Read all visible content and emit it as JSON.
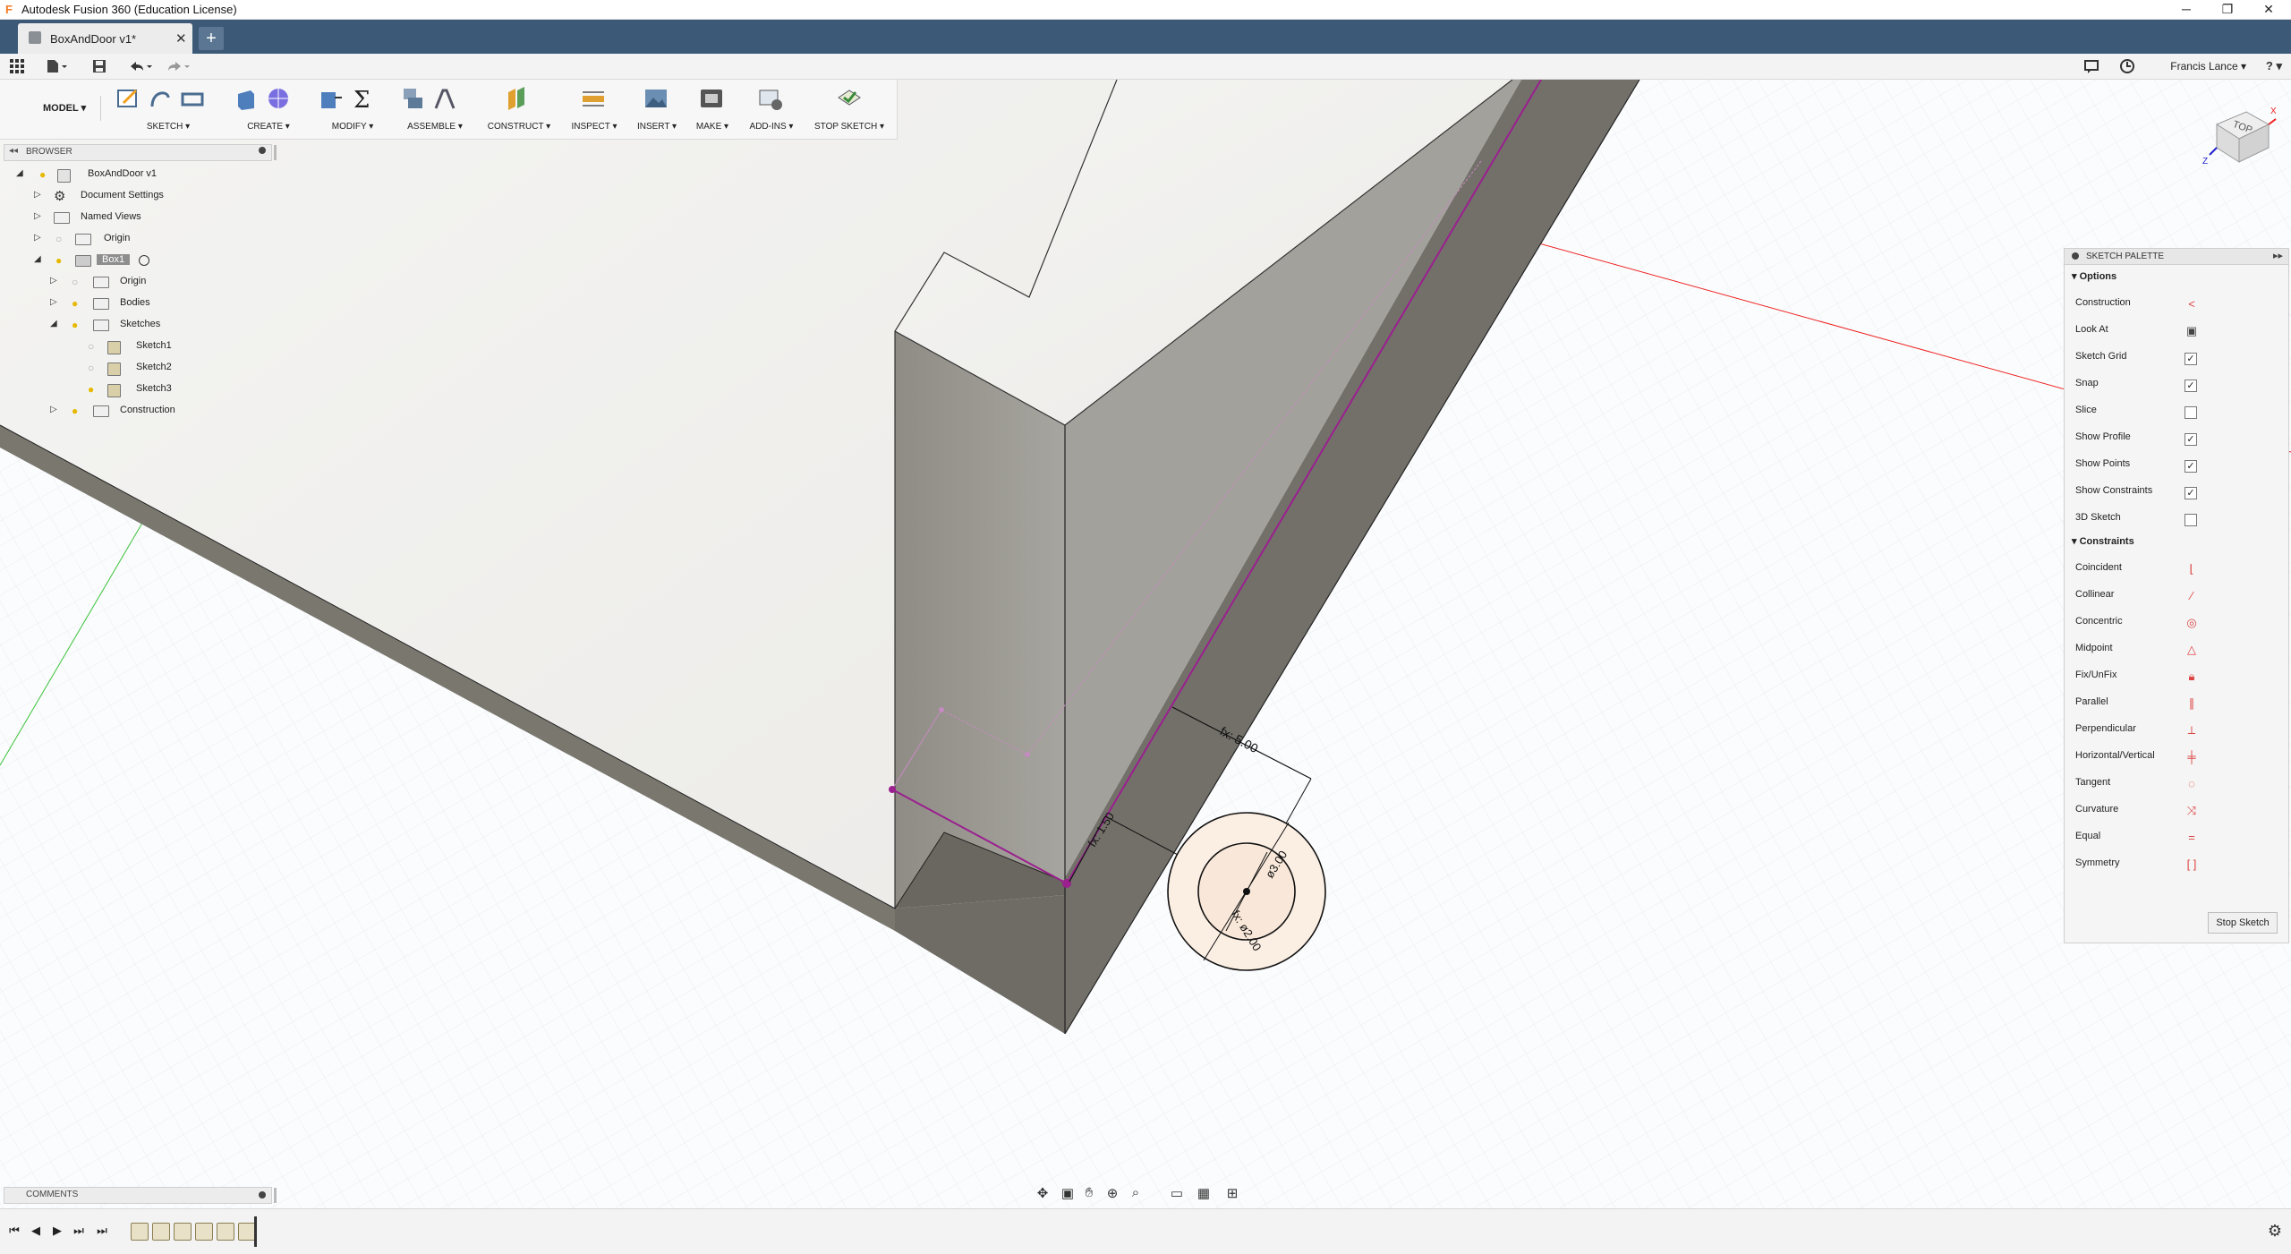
{
  "app": {
    "title": "Autodesk Fusion 360 (Education License)",
    "window_buttons": {
      "minimize": "─",
      "restore": "❐",
      "close": "✕"
    }
  },
  "tabs": {
    "doc_label": "BoxAndDoor v1*",
    "close": "✕",
    "new": "+"
  },
  "quickbar": {
    "user": "Francis Lance ▾",
    "help": "? ▾"
  },
  "toolbar": {
    "workspace": "MODEL ▾",
    "groups": [
      {
        "label": "SKETCH ▾"
      },
      {
        "label": "CREATE ▾"
      },
      {
        "label": "MODIFY ▾"
      },
      {
        "label": "ASSEMBLE ▾"
      },
      {
        "label": "CONSTRUCT ▾"
      },
      {
        "label": "INSPECT ▾"
      },
      {
        "label": "INSERT ▾"
      },
      {
        "label": "MAKE ▾"
      },
      {
        "label": "ADD-INS ▾"
      },
      {
        "label": "STOP SKETCH ▾"
      }
    ]
  },
  "browser": {
    "title": "BROWSER",
    "items": [
      {
        "label": "BoxAndDoor v1"
      },
      {
        "label": "Document Settings"
      },
      {
        "label": "Named Views"
      },
      {
        "label": "Origin"
      },
      {
        "label": "Box1"
      },
      {
        "label": "Origin"
      },
      {
        "label": "Bodies"
      },
      {
        "label": "Sketches"
      },
      {
        "label": "Sketch1"
      },
      {
        "label": "Sketch2"
      },
      {
        "label": "Sketch3"
      },
      {
        "label": "Construction"
      }
    ]
  },
  "viewcube": {
    "face": "TOP",
    "axis_x": "X",
    "axis_z": "Z"
  },
  "dimensions": {
    "d1": "fx: 5.00",
    "d2": "fx: 1.50",
    "d3": "ø3.00",
    "d4": "fx: ø2.00"
  },
  "palette": {
    "title": "SKETCH PALETTE",
    "options_title": "Options",
    "options": [
      {
        "label": "Construction",
        "checked": null
      },
      {
        "label": "Look At",
        "checked": null
      },
      {
        "label": "Sketch Grid",
        "checked": true
      },
      {
        "label": "Snap",
        "checked": true
      },
      {
        "label": "Slice",
        "checked": false
      },
      {
        "label": "Show Profile",
        "checked": true
      },
      {
        "label": "Show Points",
        "checked": true
      },
      {
        "label": "Show Constraints",
        "checked": true
      },
      {
        "label": "3D Sketch",
        "checked": false
      }
    ],
    "constraints_title": "Constraints",
    "constraints": [
      {
        "label": "Coincident",
        "icon": "coincident-icon"
      },
      {
        "label": "Collinear",
        "icon": "collinear-icon"
      },
      {
        "label": "Concentric",
        "icon": "concentric-icon"
      },
      {
        "label": "Midpoint",
        "icon": "midpoint-icon"
      },
      {
        "label": "Fix/UnFix",
        "icon": "lock-icon"
      },
      {
        "label": "Parallel",
        "icon": "parallel-icon"
      },
      {
        "label": "Perpendicular",
        "icon": "perpendicular-icon"
      },
      {
        "label": "Horizontal/Vertical",
        "icon": "horizontal-vertical-icon"
      },
      {
        "label": "Tangent",
        "icon": "tangent-icon"
      },
      {
        "label": "Curvature",
        "icon": "curvature-icon"
      },
      {
        "label": "Equal",
        "icon": "equal-icon"
      },
      {
        "label": "Symmetry",
        "icon": "symmetry-icon"
      }
    ],
    "stop_button": "Stop Sketch"
  },
  "comments": {
    "title": "COMMENTS"
  },
  "colors": {
    "accent": "#3c5a78",
    "sketch_line": "#9b1f8f",
    "x_axis": "#e02020",
    "y_axis": "#20c020"
  }
}
